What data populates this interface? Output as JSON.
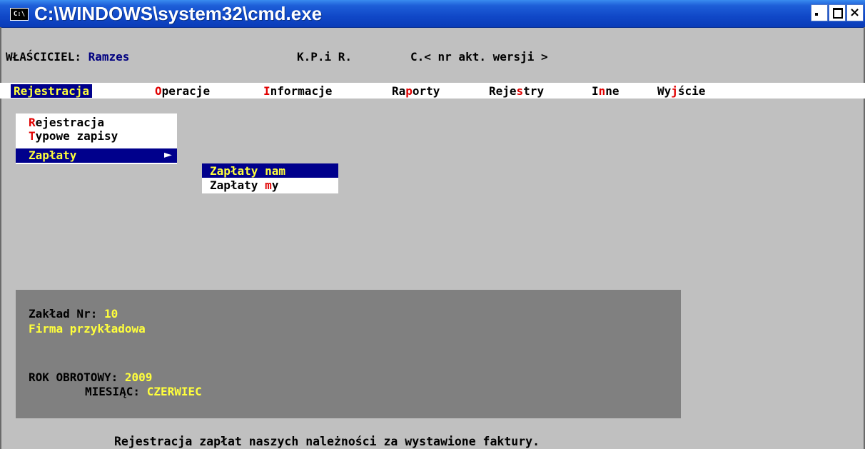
{
  "window": {
    "title": "C:\\WINDOWS\\system32\\cmd.exe",
    "icon_text": "C:\\",
    "close_glyph": "×"
  },
  "status": {
    "owner_label": "WŁAŚCICIEL:",
    "owner_value": "Ramzes",
    "app": "K.P.i R.",
    "version": "C.< nr akt. wersji >"
  },
  "menu": {
    "items": [
      {
        "hot": "",
        "rest": "Rejestracja",
        "selected": true
      },
      {
        "hot": "O",
        "rest": "peracje"
      },
      {
        "hot": "I",
        "rest": "nformacje"
      },
      {
        "pre": "Ra",
        "hot": "p",
        "rest": "orty"
      },
      {
        "pre": "Reje",
        "hot": "s",
        "rest": "try"
      },
      {
        "pre": "I",
        "hot": "n",
        "rest": "ne"
      },
      {
        "pre": "Wy",
        "hot": "j",
        "rest": "ście"
      }
    ]
  },
  "dropdown": {
    "items": [
      {
        "hot": "R",
        "rest": "ejestracja"
      },
      {
        "hot": "T",
        "rest": "ypowe zapisy"
      },
      {
        "hot": "",
        "rest": "Zapłaty",
        "selected": true
      }
    ],
    "submenu_arrow": "►"
  },
  "submenu": {
    "items": [
      {
        "text": "Zapłaty nam",
        "selected": true
      },
      {
        "pre": "Zapłaty ",
        "hot": "m",
        "rest": "y"
      }
    ]
  },
  "info": {
    "zaklad_label": "Zakład Nr:",
    "zaklad_value": "10",
    "firma": "Firma przykładowa",
    "rok_label": "ROK OBROTOWY:",
    "rok_value": "2009",
    "miesiac_label": "MIESIĄC:",
    "miesiac_value": "CZERWIEC"
  },
  "hint": "Rejestracja zapłat naszych należności za wystawione faktury.",
  "colors": {
    "background": "#c0c0c0",
    "highlight": "#00008c",
    "highlight_text": "#ffff3c",
    "hotkey": "#e00000",
    "panel": "#808080"
  }
}
